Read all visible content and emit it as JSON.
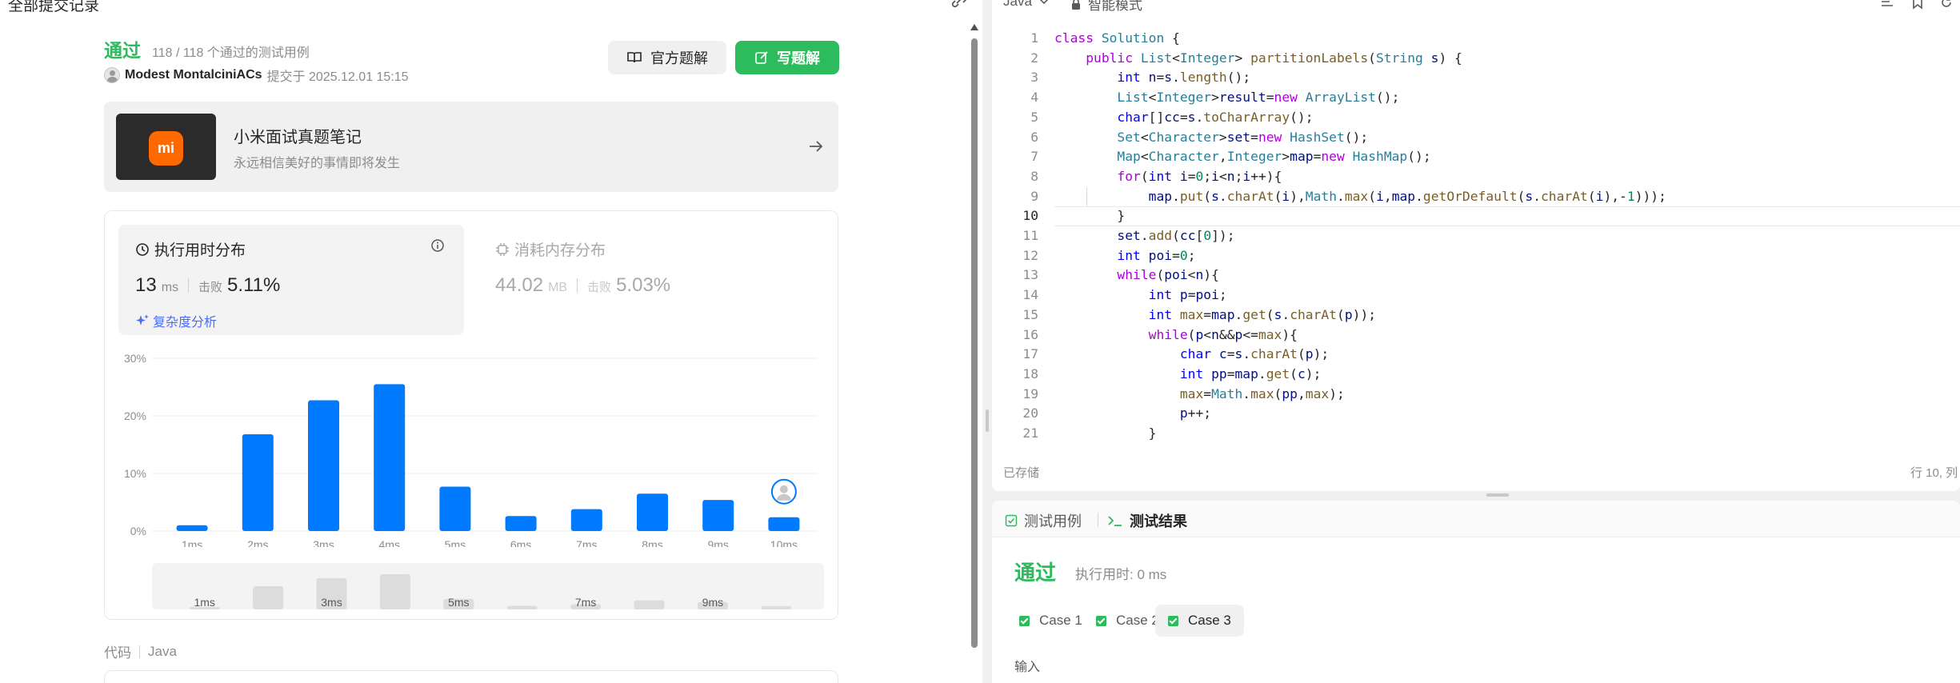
{
  "left": {
    "page_heading": "全部提交记录",
    "status": "通过",
    "cases_summary": "118 / 118 个通过的测试用例",
    "author": "Modest MontalciniACs",
    "submitted": "提交于 2025.12.01 15:15",
    "btn_solution": "官方题解",
    "btn_write": "写题解",
    "promo": {
      "logo": "mi",
      "title": "小米面试真题笔记",
      "subtitle": "永远相信美好的事情即将发生"
    },
    "runtime": {
      "title": "执行用时分布",
      "value": "13",
      "unit": "ms",
      "beat_label": "击败",
      "beat_value": "5.11%",
      "complexity": "复杂度分析"
    },
    "memory": {
      "title": "消耗内存分布",
      "value": "44.02",
      "unit": "MB",
      "beat_label": "击败",
      "beat_value": "5.03%"
    },
    "code_label": "代码",
    "code_lang": "Java"
  },
  "chart_data": {
    "type": "bar",
    "categories": [
      "1ms",
      "2ms",
      "3ms",
      "4ms",
      "5ms",
      "6ms",
      "7ms",
      "8ms",
      "9ms",
      "10ms"
    ],
    "values": [
      1.0,
      16.8,
      22.7,
      25.5,
      7.7,
      2.6,
      3.8,
      6.5,
      5.4,
      2.4
    ],
    "ytick_labels": [
      "0%",
      "10%",
      "20%",
      "30%"
    ],
    "ylim": [
      0,
      30
    ],
    "grid": true,
    "highlight_category": "10ms",
    "bar_color": "#007aff",
    "overview": {
      "labels": [
        "1ms",
        "3ms",
        "5ms",
        "7ms",
        "9ms"
      ],
      "values": [
        1.0,
        16.8,
        22.7,
        25.5,
        7.7,
        2.6,
        3.8,
        6.5,
        5.4,
        2.4
      ]
    }
  },
  "editor": {
    "language": "Java",
    "mode": "智能模式",
    "saved": "已存储",
    "cursor_pos": "行 10, 列",
    "active_line": 10
  },
  "code_lines": [
    "class Solution {",
    "    public List<Integer> partitionLabels(String s) {",
    "        int n=s.length();",
    "        List<Integer>result=new ArrayList();",
    "        char[]cc=s.toCharArray();",
    "        Set<Character>set=new HashSet();",
    "        Map<Character,Integer>map=new HashMap();",
    "        for(int i=0;i<n;i++){",
    "            map.put(s.charAt(i),Math.max(i,map.getOrDefault(s.charAt(i),-1)));",
    "        }",
    "        set.add(cc[0]);",
    "        int poi=0;",
    "        while(poi<n){",
    "            int p=poi;",
    "            int max=map.get(s.charAt(p));",
    "            while(p<n&&p<=max){",
    "                char c=s.charAt(p);",
    "                int pp=map.get(c);",
    "                max=Math.max(pp,max);",
    "                p++;",
    "            }"
  ],
  "tests": {
    "tab_cases": "测试用例",
    "tab_results": "测试结果",
    "result": "通过",
    "runtime": "执行用时: 0 ms",
    "cases": [
      "Case 1",
      "Case 2",
      "Case 3"
    ],
    "selected_case": "Case 3",
    "input_label": "输入"
  },
  "colors": {
    "accent_green": "#2cbb5d",
    "bar_blue": "#007aff",
    "link_blue": "#4a6cf7"
  }
}
